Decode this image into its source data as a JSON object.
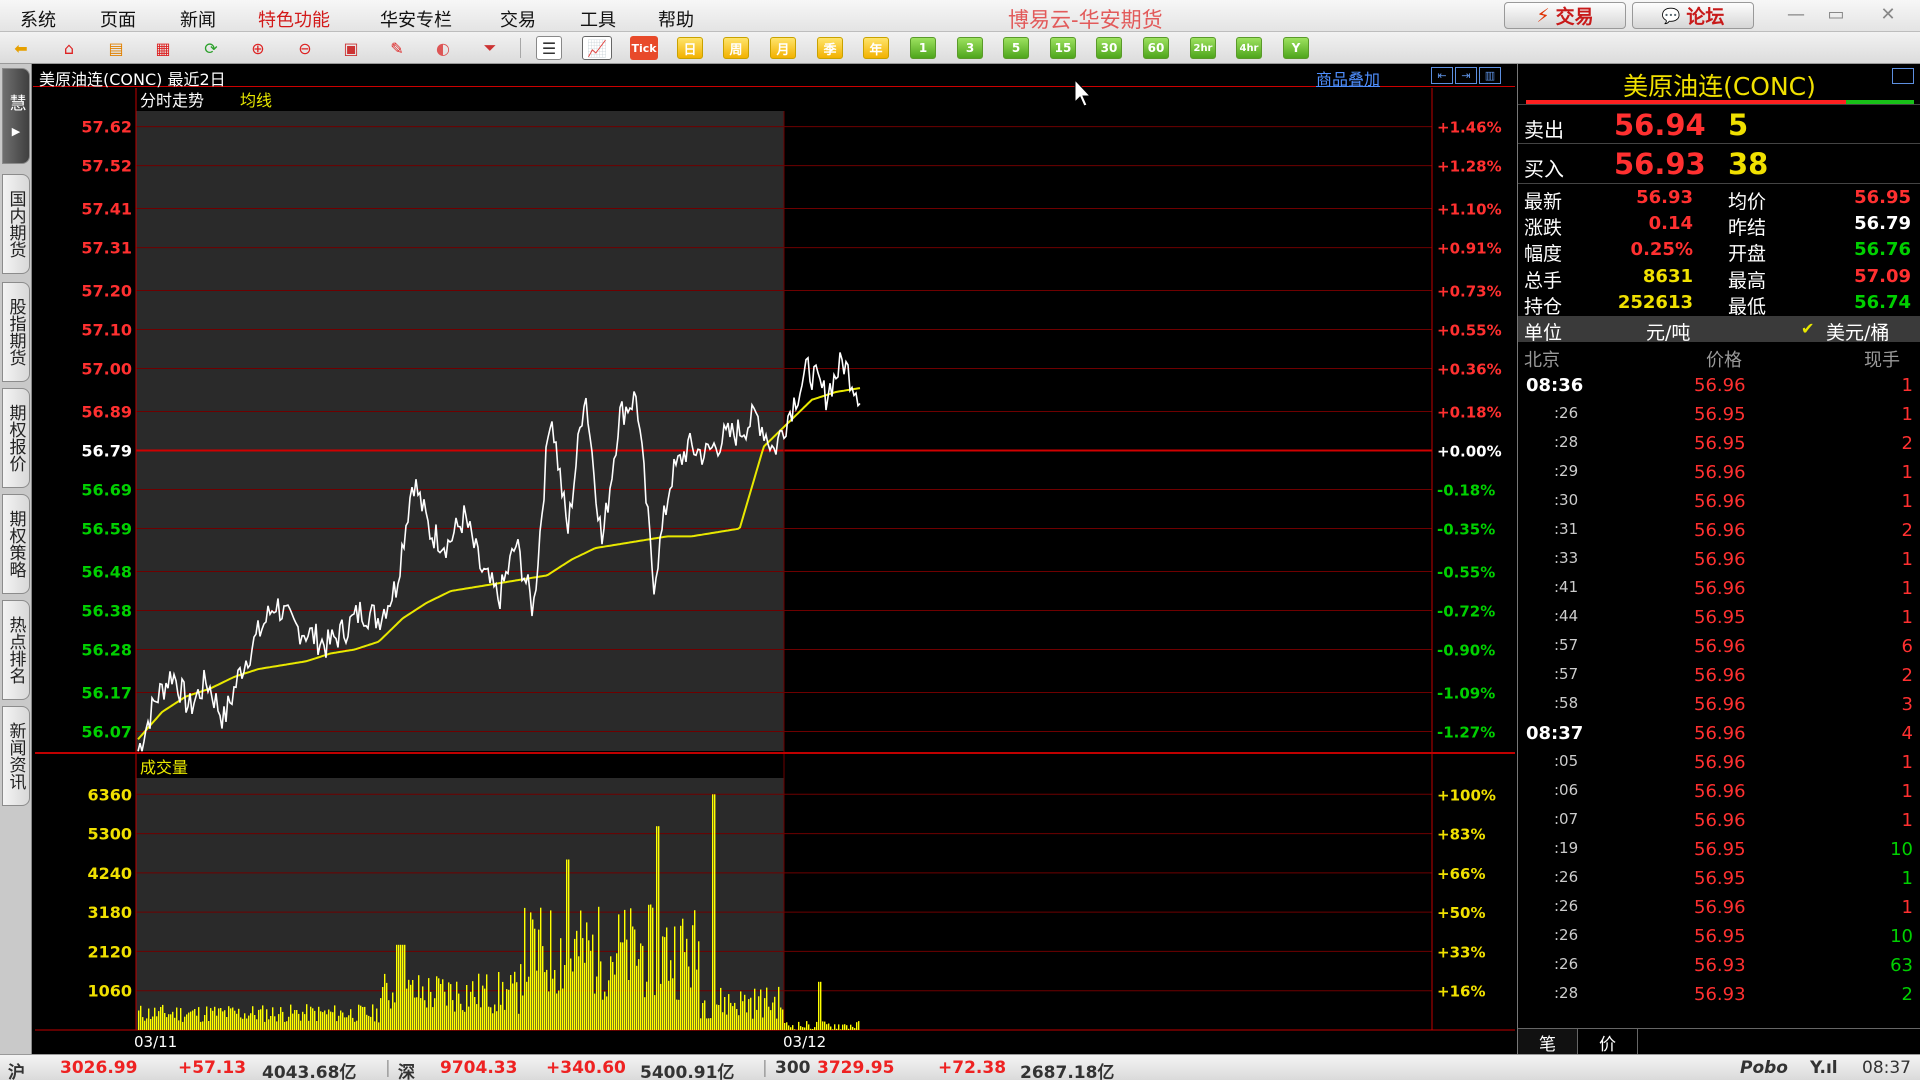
{
  "app_title": "博易云-华安期货",
  "menu": [
    "系统",
    "页面",
    "新闻",
    "特色功能",
    "华安专栏",
    "交易",
    "工具",
    "帮助"
  ],
  "top_buttons": {
    "trade": "交易",
    "forum": "论坛"
  },
  "toolbar": {
    "tick_label": "Tick",
    "periods": [
      "日",
      "周",
      "月",
      "季",
      "年"
    ],
    "minutes": [
      "1",
      "3",
      "5",
      "15",
      "30",
      "60",
      "2hr",
      "4hr",
      "Y"
    ]
  },
  "left_tabs": [
    "慧",
    "国内期货",
    "股指期货",
    "期权报价",
    "期权策略",
    "热点排名",
    "新闻资讯"
  ],
  "chart": {
    "title": "美原油连(CONC) 最近2日",
    "overlay_link": "商品叠加",
    "price_legend": "分时走势",
    "avg_legend": "均线",
    "volume_legend": "成交量",
    "price_ticks": [
      "57.62",
      "57.52",
      "57.41",
      "57.31",
      "57.20",
      "57.10",
      "57.00",
      "56.89",
      "56.79",
      "56.69",
      "56.59",
      "56.48",
      "56.38",
      "56.28",
      "56.17",
      "56.07"
    ],
    "pct_ticks": [
      "+1.46%",
      "+1.28%",
      "+1.10%",
      "+0.91%",
      "+0.73%",
      "+0.55%",
      "+0.36%",
      "+0.18%",
      "+0.00%",
      "-0.18%",
      "-0.35%",
      "-0.55%",
      "-0.72%",
      "-0.90%",
      "-1.09%",
      "-1.27%"
    ],
    "vol_ticks": [
      "6360",
      "5300",
      "4240",
      "3180",
      "2120",
      "1060"
    ],
    "vol_pct_ticks": [
      "+100%",
      "+83%",
      "+66%",
      "+50%",
      "+33%",
      "+16%"
    ],
    "dates": [
      "03/11",
      "03/12"
    ]
  },
  "chart_data": {
    "type": "line",
    "title": "美原油连(CONC) 最近2日",
    "ylim": [
      56.02,
      57.66
    ],
    "prev_settle": 56.79,
    "x": [
      "03/11",
      "03/12"
    ],
    "series": [
      {
        "name": "分时走势",
        "values": [
          56.02,
          56.15,
          56.22,
          56.13,
          56.2,
          56.1,
          56.23,
          56.32,
          56.4,
          56.34,
          56.32,
          56.29,
          56.33,
          56.38,
          56.36,
          56.44,
          56.72,
          56.58,
          56.55,
          56.62,
          56.48,
          56.41,
          56.55,
          56.38,
          56.9,
          56.58,
          56.95,
          56.55,
          56.88,
          56.93,
          56.45,
          56.72,
          56.8,
          56.78,
          56.82,
          56.84,
          56.88,
          56.79,
          56.9,
          57.0,
          56.93,
          57.02,
          56.93
        ]
      },
      {
        "name": "均线",
        "values": [
          56.05,
          56.12,
          56.16,
          56.18,
          56.21,
          56.23,
          56.24,
          56.25,
          56.27,
          56.28,
          56.3,
          56.36,
          56.4,
          56.43,
          56.44,
          56.45,
          56.46,
          56.47,
          56.51,
          56.54,
          56.55,
          56.56,
          56.57,
          56.57,
          56.58,
          56.59,
          56.8,
          56.86,
          56.92,
          56.94,
          56.95
        ]
      }
    ],
    "volume": {
      "ymax": 6360,
      "peak": 6360
    }
  },
  "quote": {
    "name": "美原油连(CONC)",
    "sell_label": "卖出",
    "sell_price": "56.94",
    "sell_qty": "5",
    "buy_label": "买入",
    "buy_price": "56.93",
    "buy_qty": "38",
    "rows": [
      {
        "k1": "最新",
        "v1": "56.93",
        "k2": "均价",
        "v2": "56.95"
      },
      {
        "k1": "涨跌",
        "v1": "0.14",
        "k2": "昨结",
        "v2": "56.79"
      },
      {
        "k1": "幅度",
        "v1": "0.25%",
        "k2": "开盘",
        "v2": "56.76"
      },
      {
        "k1": "总手",
        "v1": "8631",
        "k2": "最高",
        "v2": "57.09"
      },
      {
        "k1": "持仓",
        "v1": "252613",
        "k2": "最低",
        "v2": "56.74"
      }
    ],
    "unit_label": "单位",
    "unit_cny": "元/吨",
    "unit_usd": "美元/桶",
    "tick_headers": {
      "time": "北京",
      "price": "价格",
      "qty": "现手"
    },
    "ticks": [
      {
        "t": "08:36",
        "p": "56.96",
        "q": "1",
        "major": true
      },
      {
        "t": ":26",
        "p": "56.95",
        "q": "1"
      },
      {
        "t": ":28",
        "p": "56.95",
        "q": "2"
      },
      {
        "t": ":29",
        "p": "56.96",
        "q": "1"
      },
      {
        "t": ":30",
        "p": "56.96",
        "q": "1"
      },
      {
        "t": ":31",
        "p": "56.96",
        "q": "2"
      },
      {
        "t": ":33",
        "p": "56.96",
        "q": "1"
      },
      {
        "t": ":41",
        "p": "56.96",
        "q": "1"
      },
      {
        "t": ":44",
        "p": "56.95",
        "q": "1"
      },
      {
        "t": ":57",
        "p": "56.96",
        "q": "6"
      },
      {
        "t": ":57",
        "p": "56.96",
        "q": "2"
      },
      {
        "t": ":58",
        "p": "56.96",
        "q": "3"
      },
      {
        "t": "08:37",
        "p": "56.96",
        "q": "4",
        "major": true
      },
      {
        "t": ":05",
        "p": "56.96",
        "q": "1"
      },
      {
        "t": ":06",
        "p": "56.96",
        "q": "1"
      },
      {
        "t": ":07",
        "p": "56.96",
        "q": "1"
      },
      {
        "t": ":19",
        "p": "56.95",
        "q": "10"
      },
      {
        "t": ":26",
        "p": "56.95",
        "q": "1"
      },
      {
        "t": ":26",
        "p": "56.96",
        "q": "1"
      },
      {
        "t": ":26",
        "p": "56.95",
        "q": "10"
      },
      {
        "t": ":26",
        "p": "56.93",
        "q": "63"
      },
      {
        "t": ":28",
        "p": "56.93",
        "q": "2"
      }
    ],
    "bottom_tabs": [
      "笔",
      "价"
    ]
  },
  "status": {
    "sh_label": "沪",
    "sh_val": "3026.99",
    "sh_chg": "+57.13",
    "sh_amt": "4043.68亿",
    "sz_label": "深",
    "sz_val": "9704.33",
    "sz_chg": "+340.60",
    "sz_amt": "5400.91亿",
    "hs_label": "300",
    "hs_val": "3729.95",
    "hs_chg": "+72.38",
    "hs_amt": "2687.18亿",
    "brand": "Pobo",
    "signal": "Y.ıl",
    "time": "08:37"
  },
  "colors": {
    "up": "#ff3030",
    "down": "#00d000",
    "price_line": "#ffffff",
    "avg_line": "#e8e800",
    "volume": "#ffff00",
    "grid": "#8a0000"
  }
}
